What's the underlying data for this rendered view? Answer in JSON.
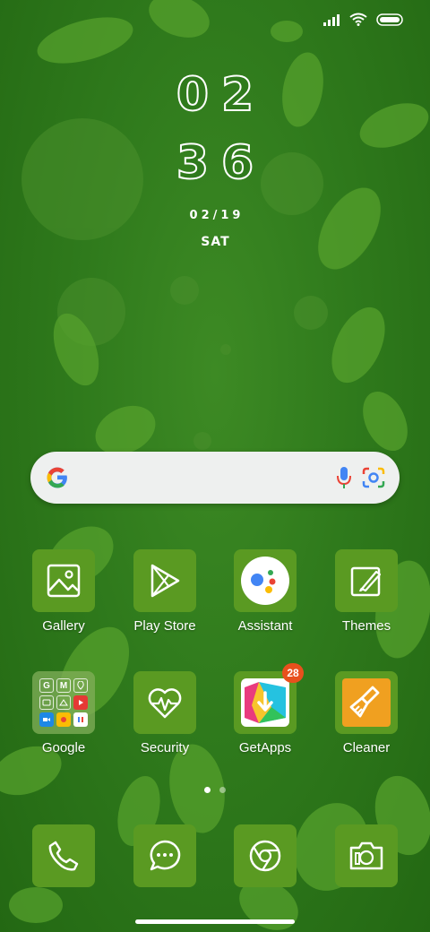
{
  "clock": {
    "hours": "02",
    "minutes": "36",
    "date": "02/19",
    "day": "SAT"
  },
  "status_bar": {
    "icons": [
      "signal-icon",
      "wifi-icon",
      "battery-icon"
    ]
  },
  "search_bar": {
    "icons": [
      "google-g-icon",
      "microphone-icon",
      "lens-camera-icon"
    ]
  },
  "apps": [
    {
      "label": "Gallery",
      "icon": "gallery-icon"
    },
    {
      "label": "Play Store",
      "icon": "play-store-icon"
    },
    {
      "label": "Assistant",
      "icon": "assistant-icon"
    },
    {
      "label": "Themes",
      "icon": "themes-icon"
    },
    {
      "label": "Google",
      "icon": "google-folder-icon",
      "folder_letters": [
        "G",
        "M",
        ""
      ]
    },
    {
      "label": "Security",
      "icon": "security-icon"
    },
    {
      "label": "GetApps",
      "icon": "getapps-icon",
      "badge": "28"
    },
    {
      "label": "Cleaner",
      "icon": "cleaner-icon"
    }
  ],
  "page_indicator": {
    "pages": 2,
    "current": 1
  },
  "dock": [
    {
      "icon": "phone-icon"
    },
    {
      "icon": "messages-icon"
    },
    {
      "icon": "browser-icon"
    },
    {
      "icon": "camera-icon"
    }
  ],
  "colors": {
    "wallpaper": "#2f7a1c",
    "tile": "#5a9a22",
    "badge": "#e8501d",
    "cleaner": "#f0a020"
  }
}
